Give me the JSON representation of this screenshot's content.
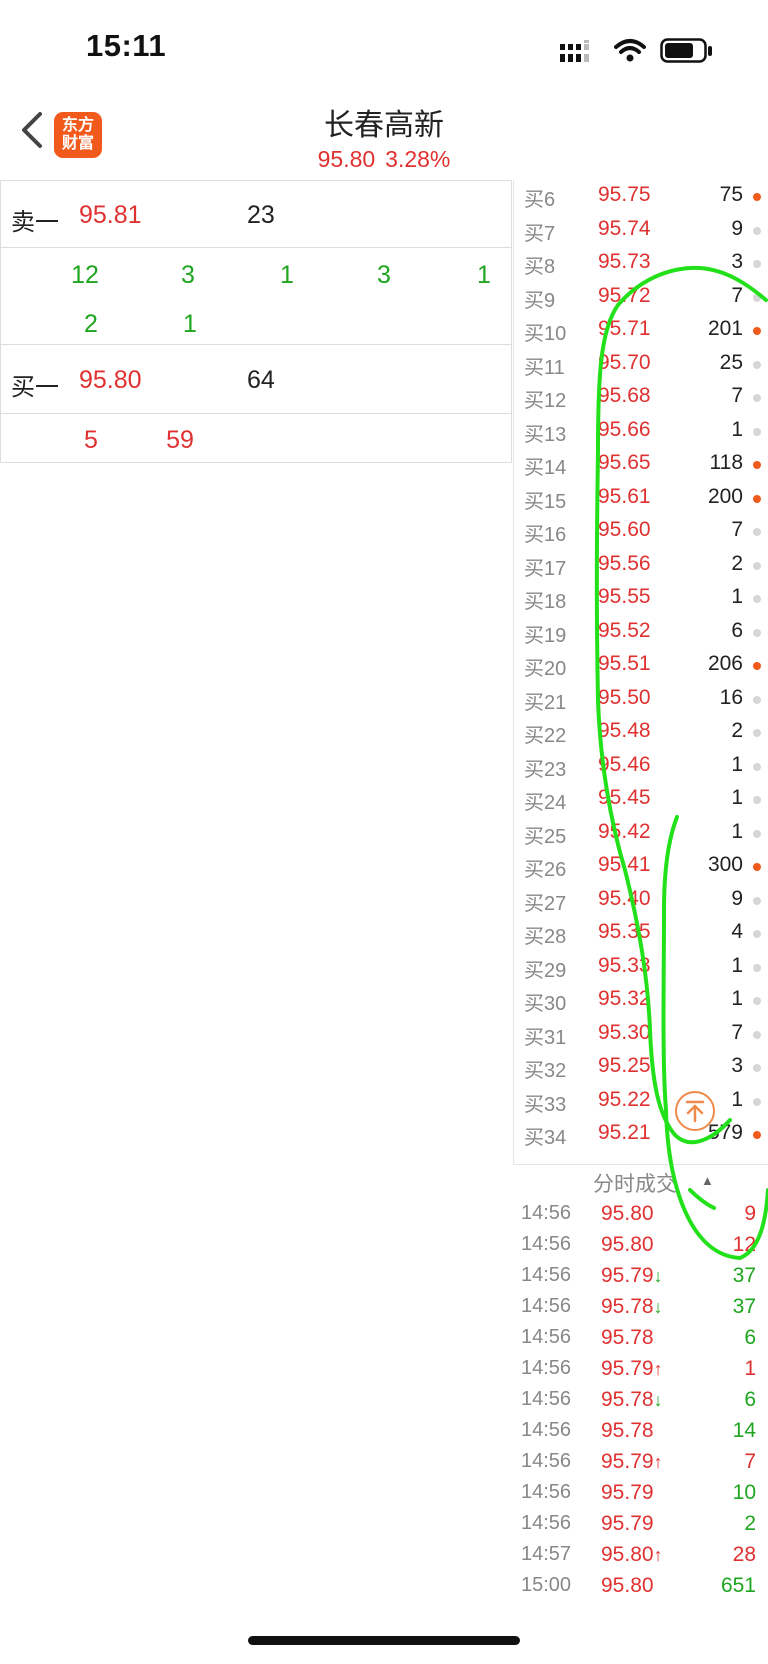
{
  "status_bar": {
    "time": "15:11"
  },
  "header": {
    "logo_line1": "东方",
    "logo_line2": "财富",
    "title": "长春高新",
    "price": "95.80",
    "change_pct": "3.28%"
  },
  "order_book": {
    "ask1": {
      "label": "卖一",
      "price": "95.81",
      "volume": "23"
    },
    "ask1_queue": [
      [
        "12",
        "3",
        "1",
        "3",
        "1"
      ],
      [
        "2",
        "1"
      ]
    ],
    "bid1": {
      "label": "买一",
      "price": "95.80",
      "volume": "64"
    },
    "bid1_queue": [
      [
        "5",
        "59"
      ]
    ]
  },
  "buy_levels": [
    {
      "label": "买6",
      "price": "95.75",
      "volume": "75",
      "dot": "orange"
    },
    {
      "label": "买7",
      "price": "95.74",
      "volume": "9",
      "dot": "gray"
    },
    {
      "label": "买8",
      "price": "95.73",
      "volume": "3",
      "dot": "gray"
    },
    {
      "label": "买9",
      "price": "95.72",
      "volume": "7",
      "dot": "gray"
    },
    {
      "label": "买10",
      "price": "95.71",
      "volume": "201",
      "dot": "orange"
    },
    {
      "label": "买11",
      "price": "95.70",
      "volume": "25",
      "dot": "gray"
    },
    {
      "label": "买12",
      "price": "95.68",
      "volume": "7",
      "dot": "gray"
    },
    {
      "label": "买13",
      "price": "95.66",
      "volume": "1",
      "dot": "gray"
    },
    {
      "label": "买14",
      "price": "95.65",
      "volume": "118",
      "dot": "orange"
    },
    {
      "label": "买15",
      "price": "95.61",
      "volume": "200",
      "dot": "orange"
    },
    {
      "label": "买16",
      "price": "95.60",
      "volume": "7",
      "dot": "gray"
    },
    {
      "label": "买17",
      "price": "95.56",
      "volume": "2",
      "dot": "gray"
    },
    {
      "label": "买18",
      "price": "95.55",
      "volume": "1",
      "dot": "gray"
    },
    {
      "label": "买19",
      "price": "95.52",
      "volume": "6",
      "dot": "gray"
    },
    {
      "label": "买20",
      "price": "95.51",
      "volume": "206",
      "dot": "orange"
    },
    {
      "label": "买21",
      "price": "95.50",
      "volume": "16",
      "dot": "gray"
    },
    {
      "label": "买22",
      "price": "95.48",
      "volume": "2",
      "dot": "gray"
    },
    {
      "label": "买23",
      "price": "95.46",
      "volume": "1",
      "dot": "gray"
    },
    {
      "label": "买24",
      "price": "95.45",
      "volume": "1",
      "dot": "gray"
    },
    {
      "label": "买25",
      "price": "95.42",
      "volume": "1",
      "dot": "gray"
    },
    {
      "label": "买26",
      "price": "95.41",
      "volume": "300",
      "dot": "orange"
    },
    {
      "label": "买27",
      "price": "95.40",
      "volume": "9",
      "dot": "gray"
    },
    {
      "label": "买28",
      "price": "95.35",
      "volume": "4",
      "dot": "gray"
    },
    {
      "label": "买29",
      "price": "95.33",
      "volume": "1",
      "dot": "gray"
    },
    {
      "label": "买30",
      "price": "95.32",
      "volume": "1",
      "dot": "gray"
    },
    {
      "label": "买31",
      "price": "95.30",
      "volume": "7",
      "dot": "gray"
    },
    {
      "label": "买32",
      "price": "95.25",
      "volume": "3",
      "dot": "gray"
    },
    {
      "label": "买33",
      "price": "95.22",
      "volume": "1",
      "dot": "gray"
    },
    {
      "label": "买34",
      "price": "95.21",
      "volume": "579",
      "dot": "orange"
    }
  ],
  "ticks": {
    "header": "分时成交",
    "rows": [
      {
        "time": "14:56",
        "price": "95.80",
        "arrow": "",
        "volume": "9",
        "color": "red"
      },
      {
        "time": "14:56",
        "price": "95.80",
        "arrow": "",
        "volume": "12",
        "color": "red"
      },
      {
        "time": "14:56",
        "price": "95.79",
        "arrow": "↓",
        "volume": "37",
        "color": "green"
      },
      {
        "time": "14:56",
        "price": "95.78",
        "arrow": "↓",
        "volume": "37",
        "color": "green"
      },
      {
        "time": "14:56",
        "price": "95.78",
        "arrow": "",
        "volume": "6",
        "color": "green"
      },
      {
        "time": "14:56",
        "price": "95.79",
        "arrow": "↑",
        "volume": "1",
        "color": "red"
      },
      {
        "time": "14:56",
        "price": "95.78",
        "arrow": "↓",
        "volume": "6",
        "color": "green"
      },
      {
        "time": "14:56",
        "price": "95.78",
        "arrow": "",
        "volume": "14",
        "color": "green"
      },
      {
        "time": "14:56",
        "price": "95.79",
        "arrow": "↑",
        "volume": "7",
        "color": "red"
      },
      {
        "time": "14:56",
        "price": "95.79",
        "arrow": "",
        "volume": "10",
        "color": "green"
      },
      {
        "time": "14:56",
        "price": "95.79",
        "arrow": "",
        "volume": "2",
        "color": "green"
      },
      {
        "time": "14:57",
        "price": "95.80",
        "arrow": "↑",
        "volume": "28",
        "color": "red"
      },
      {
        "time": "15:00",
        "price": "95.80",
        "arrow": "",
        "volume": "651",
        "color": "green"
      }
    ]
  },
  "colors": {
    "up": "#e03131",
    "down": "#1fa51f",
    "accent": "#f25a1c",
    "annotation": "#22e01a"
  }
}
